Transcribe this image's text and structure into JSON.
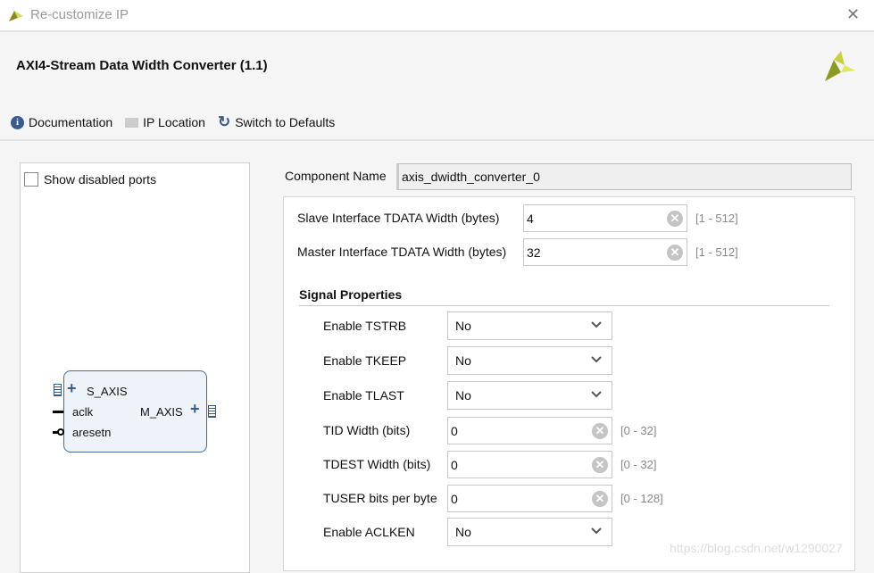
{
  "window": {
    "title": "Re-customize IP",
    "close": "✕"
  },
  "header": {
    "title": "AXI4-Stream Data Width Converter (1.1)"
  },
  "toolbar": {
    "documentation": "Documentation",
    "ip_location": "IP Location",
    "switch_defaults": "Switch to Defaults"
  },
  "left": {
    "show_disabled_ports": "Show disabled ports",
    "show_disabled_checked": false,
    "block": {
      "s_axis": "S_AXIS",
      "aclk": "aclk",
      "aresetn": "aresetn",
      "m_axis": "M_AXIS"
    }
  },
  "component": {
    "label": "Component Name",
    "value": "axis_dwidth_converter_0"
  },
  "params": [
    {
      "label": "Slave Interface TDATA Width (bytes)",
      "value": "4",
      "range": "[1 - 512]"
    },
    {
      "label": "Master Interface TDATA Width (bytes)",
      "value": "32",
      "range": "[1 - 512]"
    }
  ],
  "signal_properties": {
    "title": "Signal Properties",
    "rows": [
      {
        "label": "Enable TSTRB",
        "type": "select",
        "value": "No"
      },
      {
        "label": "Enable TKEEP",
        "type": "select",
        "value": "No"
      },
      {
        "label": "Enable TLAST",
        "type": "select",
        "value": "No"
      },
      {
        "label": "TID Width (bits)",
        "type": "input",
        "value": "0",
        "range": "[0 - 32]"
      },
      {
        "label": "TDEST Width (bits)",
        "type": "input",
        "value": "0",
        "range": "[0 - 32]"
      },
      {
        "label": "TUSER bits per byte",
        "type": "input",
        "value": "0",
        "range": "[0 - 128]"
      },
      {
        "label": "Enable ACLKEN",
        "type": "select",
        "value": "No"
      }
    ]
  },
  "watermark": "https://blog.csdn.net/w1290027",
  "colors": {
    "accent": "#3b5a8c",
    "logo": "#b9c21d"
  }
}
